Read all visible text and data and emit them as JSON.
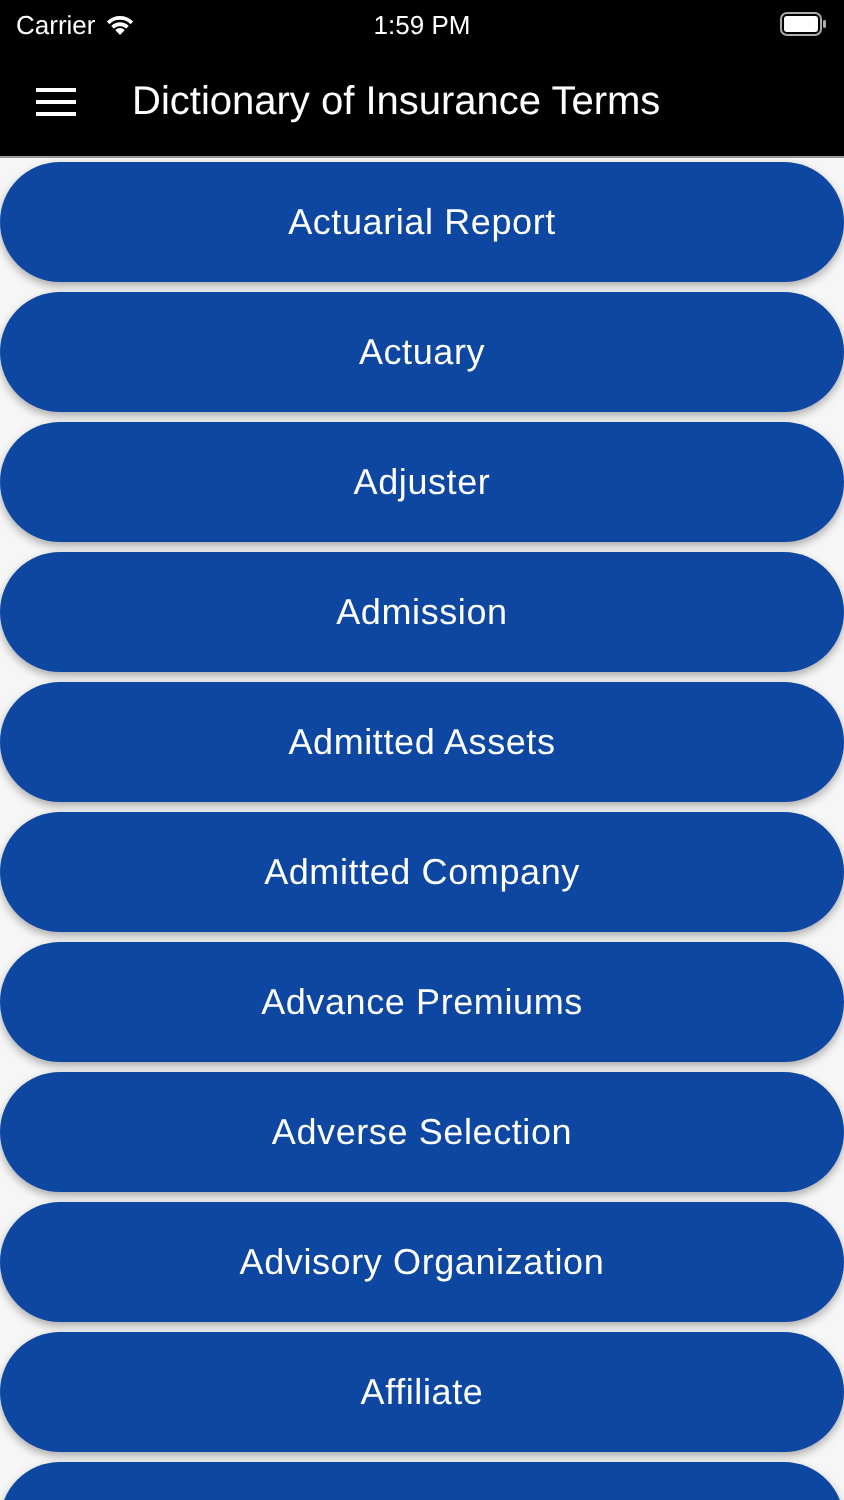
{
  "status_bar": {
    "carrier": "Carrier",
    "time": "1:59 PM"
  },
  "app_bar": {
    "title": "Dictionary of Insurance Terms"
  },
  "terms": [
    {
      "kind": "term",
      "label": "Actuarial Report"
    },
    {
      "kind": "term",
      "label": "Actuary"
    },
    {
      "kind": "term",
      "label": "Adjuster"
    },
    {
      "kind": "term",
      "label": "Admission"
    },
    {
      "kind": "term",
      "label": "Admitted Assets"
    },
    {
      "kind": "term",
      "label": "Admitted Company"
    },
    {
      "kind": "term",
      "label": "Advance Premiums"
    },
    {
      "kind": "term",
      "label": "Adverse Selection"
    },
    {
      "kind": "term",
      "label": "Advisory Organization"
    },
    {
      "kind": "term",
      "label": "Affiliate"
    },
    {
      "kind": "cut"
    }
  ]
}
